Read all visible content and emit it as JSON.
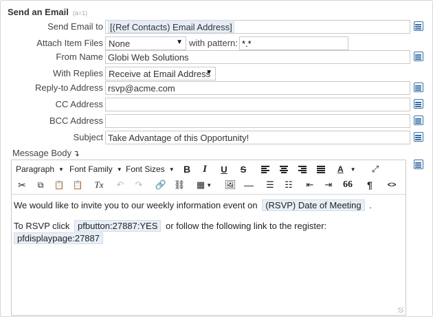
{
  "section": {
    "title": "Send an Email",
    "hint": "(a=1)"
  },
  "fields": {
    "send_to": {
      "label": "Send Email to",
      "value": "[(Ref Contacts) Email Address]"
    },
    "attach": {
      "label": "Attach Item Files",
      "value": "None",
      "pattern_label": "with pattern:",
      "pattern_value": "*.*"
    },
    "from_name": {
      "label": "From Name",
      "value": "Globi Web Solutions"
    },
    "with_replies": {
      "label": "With Replies",
      "value": "Receive at Email Address"
    },
    "reply_to": {
      "label": "Reply-to Address",
      "value": "rsvp@acme.com"
    },
    "cc": {
      "label": "CC Address",
      "value": ""
    },
    "bcc": {
      "label": "BCC Address",
      "value": ""
    },
    "subject": {
      "label": "Subject",
      "value": "Take Advantage of this Opportunity!"
    }
  },
  "message": {
    "label": "Message Body",
    "arrow": "↴"
  },
  "toolbar": {
    "paragraph": "Paragraph",
    "font_family": "Font Family",
    "font_sizes": "Font Sizes",
    "bold": "B",
    "italic": "I",
    "underline": "U",
    "strike": "S",
    "font_color": "A",
    "clear_format": "Tx",
    "quote": "66",
    "pilcrow": "¶",
    "code": "<>"
  },
  "body": {
    "line1_pre": "We would like to invite you to our weekly information event on",
    "line1_token": "(RSVP) Date of Meeting",
    "line1_post": ".",
    "line2_pre": "To RSVP click",
    "line2_token": "pfbutton:27887:YES",
    "line2_post": "or follow the following link to the register:",
    "line3_token": "pfdisplaypage:27887"
  },
  "colors": {
    "icon": "#3b6ea8",
    "token_bg": "#e8eff7"
  }
}
